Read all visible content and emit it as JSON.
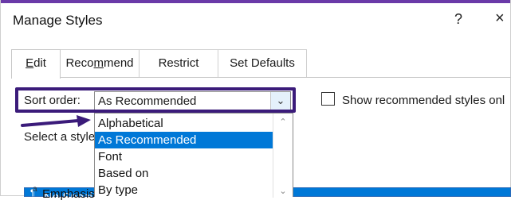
{
  "window": {
    "title": "Manage Styles",
    "help": "?",
    "close": "×"
  },
  "tabs": [
    {
      "label": "Edit",
      "active": true
    },
    {
      "label": "Recommend",
      "active": false
    },
    {
      "label": "Restrict",
      "active": false
    },
    {
      "label": "Set Defaults",
      "active": false
    }
  ],
  "sort_order": {
    "label": "Sort order:",
    "value": "As Recommended",
    "options": [
      "Alphabetical",
      "As Recommended",
      "Font",
      "Based on",
      "By type"
    ],
    "selected_index": 1
  },
  "checkbox": {
    "label": "Show recommended styles onl",
    "checked": false
  },
  "select_style": {
    "label": "Select a style"
  },
  "style_list": {
    "items": [
      {
        "marker": "¶",
        "name": "No Spaci",
        "selected": true
      },
      {
        "marker": "a",
        "name": "Emphasis",
        "selected": false
      }
    ]
  },
  "colors": {
    "accent": "#0078d7",
    "annotation": "#3b1b7a"
  }
}
